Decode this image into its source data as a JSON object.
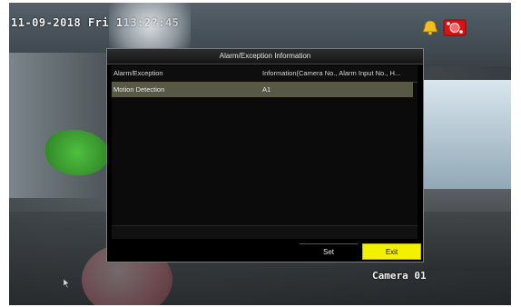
{
  "osd": {
    "datetime": "11-09-2018 Fri 1",
    "datetime_obscured": "13:2?:45",
    "camera_label": "Camera 01"
  },
  "dialog": {
    "title": "Alarm/Exception Information",
    "columns": [
      "Alarm/Exception",
      "Information(Camera No., Alarm Input No., H..."
    ],
    "rows": [
      {
        "type": "Motion Detection",
        "info": "A1",
        "selected": true
      }
    ],
    "buttons": {
      "set": "Set",
      "exit": "Exit"
    }
  },
  "colors": {
    "selected_row": "#575945",
    "exit_button": "#f3f100",
    "dialog_bg": "#000000"
  },
  "icons": [
    "bell-icon",
    "alarm-status-icon",
    "mouse-pointer-icon"
  ]
}
